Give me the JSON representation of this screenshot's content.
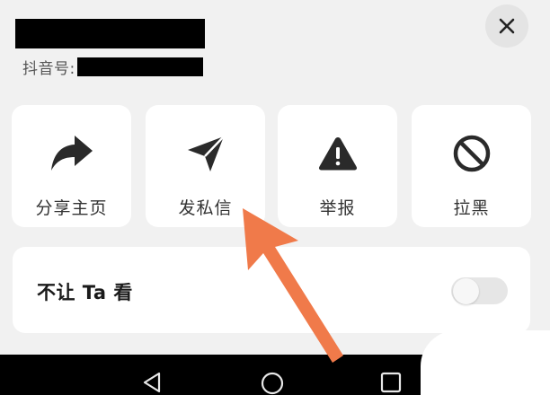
{
  "profile": {
    "id_label": "抖音号:"
  },
  "actions": [
    {
      "label": "分享主页",
      "icon": "share-icon"
    },
    {
      "label": "发私信",
      "icon": "paper-plane-icon"
    },
    {
      "label": "举报",
      "icon": "warning-icon"
    },
    {
      "label": "拉黑",
      "icon": "block-icon"
    }
  ],
  "hide_from": {
    "label": "不让 Ta 看",
    "enabled": false
  },
  "close": {
    "icon": "close-icon"
  },
  "navbar": {
    "back_icon": "back-triangle-icon",
    "home_icon": "home-circle-icon",
    "recents_icon": "recents-square-icon"
  },
  "colors": {
    "annotation_arrow": "#f07a4a",
    "tile_bg": "#ffffff",
    "sheet_bg": "#f1f1f1",
    "icon": "#2a2a2a"
  }
}
